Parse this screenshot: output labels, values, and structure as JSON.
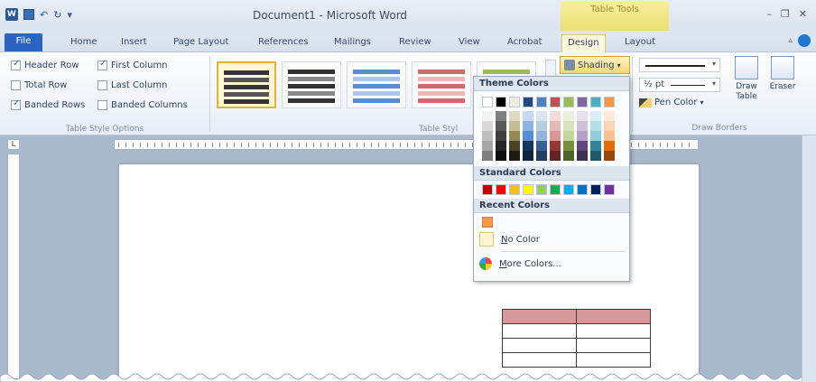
{
  "window": {
    "title": "Document1 - Microsoft Word",
    "contextual_tab": "Table Tools"
  },
  "tabs": [
    "File",
    "Home",
    "Insert",
    "Page Layout",
    "References",
    "Mailings",
    "Review",
    "View",
    "Acrobat",
    "Design",
    "Layout"
  ],
  "active_tab": "Design",
  "style_options": {
    "header_row": "Header Row",
    "first_column": "First Column",
    "total_row": "Total Row",
    "last_column": "Last Column",
    "banded_rows": "Banded Rows",
    "banded_columns": "Banded Columns",
    "group_label": "Table Style Options",
    "checked": {
      "header_row": true,
      "first_column": true,
      "total_row": false,
      "last_column": false,
      "banded_rows": true,
      "banded_columns": false
    }
  },
  "table_styles": {
    "group_label": "Table Styl",
    "styles": [
      {
        "colors": [
          "#333333",
          "#555555"
        ]
      },
      {
        "colors": [
          "#333333",
          "#888888"
        ]
      },
      {
        "colors": [
          "#5b8bd4",
          "#aac4ea"
        ]
      },
      {
        "colors": [
          "#d26a6a",
          "#eeb8b8"
        ]
      },
      {
        "colors": [
          "#9cbb5a",
          "#d2e2b0"
        ]
      }
    ]
  },
  "shading_button": "Shading",
  "draw_borders": {
    "line_weight": "½ pt",
    "pen_color": "Pen Color",
    "draw_table": "Draw Table",
    "eraser": "Eraser",
    "group_label": "Draw Borders"
  },
  "shading_menu": {
    "theme_colors_label": "Theme Colors",
    "theme_colors": [
      "#ffffff",
      "#000000",
      "#eeece1",
      "#1f497d",
      "#4f81bd",
      "#c0504d",
      "#9bbb59",
      "#8064a2",
      "#4bacc6",
      "#f79646"
    ],
    "theme_shades": [
      [
        "#f2f2f2",
        "#d9d9d9",
        "#bfbfbf",
        "#a6a6a6",
        "#7f7f7f"
      ],
      [
        "#7f7f7f",
        "#595959",
        "#404040",
        "#262626",
        "#0d0d0d"
      ],
      [
        "#ddd9c3",
        "#c4bd97",
        "#938953",
        "#494429",
        "#1d1b10"
      ],
      [
        "#c6d9f0",
        "#8db3e2",
        "#548dd4",
        "#17365d",
        "#0f243e"
      ],
      [
        "#dbe5f1",
        "#b8cce4",
        "#95b3d7",
        "#366092",
        "#244061"
      ],
      [
        "#f2dcdb",
        "#e5b9b7",
        "#d99694",
        "#953734",
        "#632423"
      ],
      [
        "#ebf1dd",
        "#d7e3bc",
        "#c3d69b",
        "#76923c",
        "#4f6128"
      ],
      [
        "#e5e0ec",
        "#ccc1d9",
        "#b2a2c7",
        "#5f497a",
        "#3f3151"
      ],
      [
        "#dbeef3",
        "#b7dde8",
        "#92cddc",
        "#31859b",
        "#205867"
      ],
      [
        "#fdeada",
        "#fbd5b5",
        "#fac08f",
        "#e36c09",
        "#974806"
      ]
    ],
    "standard_colors_label": "Standard Colors",
    "standard_colors": [
      "#c00000",
      "#ff0000",
      "#ffc000",
      "#ffff00",
      "#92d050",
      "#00b050",
      "#00b0f0",
      "#0070c0",
      "#002060",
      "#7030a0"
    ],
    "recent_colors_label": "Recent Colors",
    "recent_colors": [
      "#f79646"
    ],
    "no_color": "No Color",
    "more_colors": "More Colors..."
  },
  "document_table": {
    "rows": 4,
    "cols": 2,
    "header_color": "#d59a9a"
  }
}
